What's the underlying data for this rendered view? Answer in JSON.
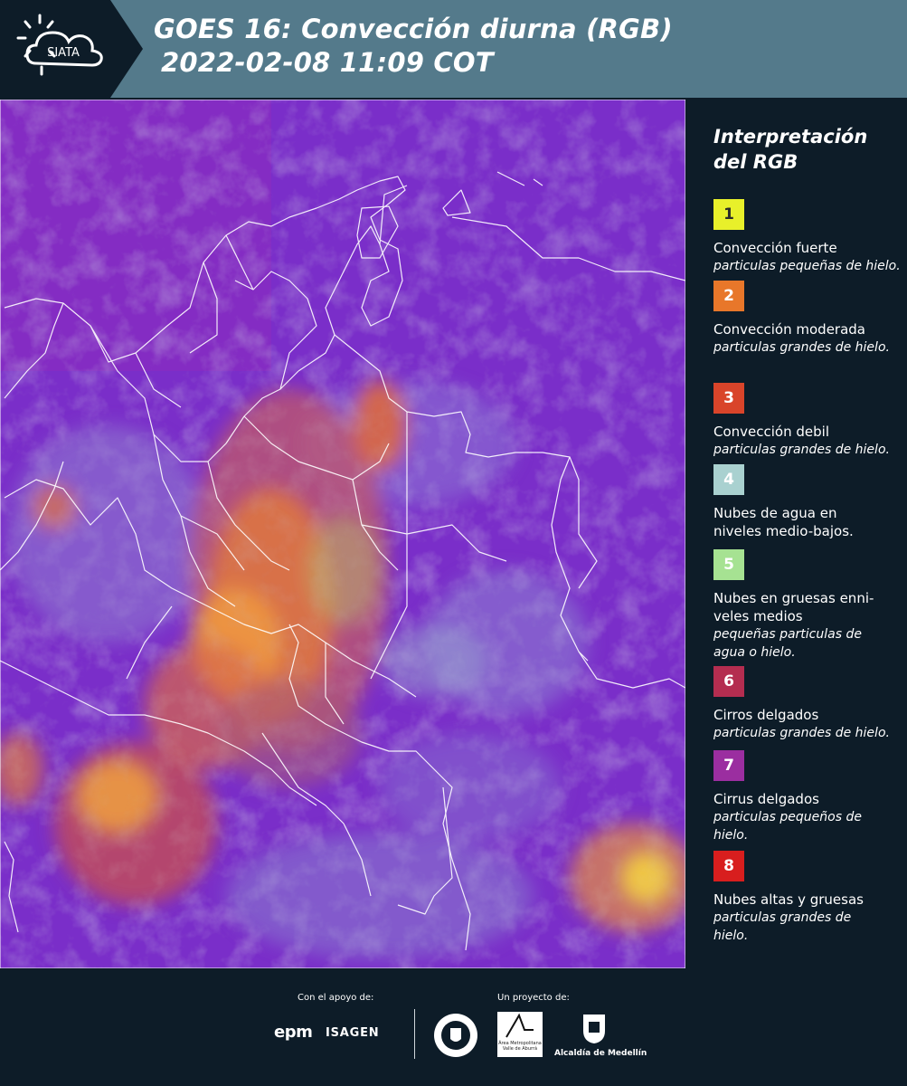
{
  "header": {
    "logo_text": "SIATA",
    "title_line1": "GOES 16: Convección diurna (RGB)",
    "title_line2": "2022-02-08 11:09 COT"
  },
  "legend": {
    "title_line1": "Interpretación",
    "title_line2": "del RGB",
    "items": [
      {
        "number": "1",
        "color": "#e8f02a",
        "text_color": "#2a2a2a",
        "label": "Convección fuerte",
        "desc": "particulas pequeñas de hielo."
      },
      {
        "number": "2",
        "color": "#e8772a",
        "text_color": "#ffffff",
        "label": "Convección moderada",
        "desc": "particulas grandes de hielo."
      },
      {
        "number": "3",
        "color": "#d9442a",
        "text_color": "#ffffff",
        "label": "Convección debil",
        "desc": "particulas grandes de hielo."
      },
      {
        "number": "4",
        "color": "#a9d1d0",
        "text_color": "#ffffff",
        "label": "Nubes de agua en niveles medio-bajos.",
        "desc": ""
      },
      {
        "number": "5",
        "color": "#a6e292",
        "text_color": "#ffffff",
        "label": "Nubes en gruesas enni-veles medios",
        "desc": "pequeñas particulas de agua o hielo."
      },
      {
        "number": "6",
        "color": "#b42d50",
        "text_color": "#ffffff",
        "label": "Cirros delgados",
        "desc": "particulas grandes de hielo."
      },
      {
        "number": "7",
        "color": "#9b2ea0",
        "text_color": "#ffffff",
        "label": "Cirrus delgados",
        "desc": "particulas pequeños de hielo."
      },
      {
        "number": "8",
        "color": "#d81e1e",
        "text_color": "#ffffff",
        "label": "Nubes altas y gruesas",
        "desc": "particulas grandes de hielo."
      }
    ]
  },
  "footer": {
    "support_label": "Con el apoyo de:",
    "project_label": "Un proyecto de:",
    "epm": "epm",
    "isagen": "ISAGEN",
    "area_metropolitana": "Área Metropolitana Valle de Aburrá",
    "alcaldia": "Alcaldía de Medellín"
  },
  "colors": {
    "header_bg": "#547a8b",
    "page_bg": "#0d1c28",
    "map_base": "#7a32c8"
  }
}
